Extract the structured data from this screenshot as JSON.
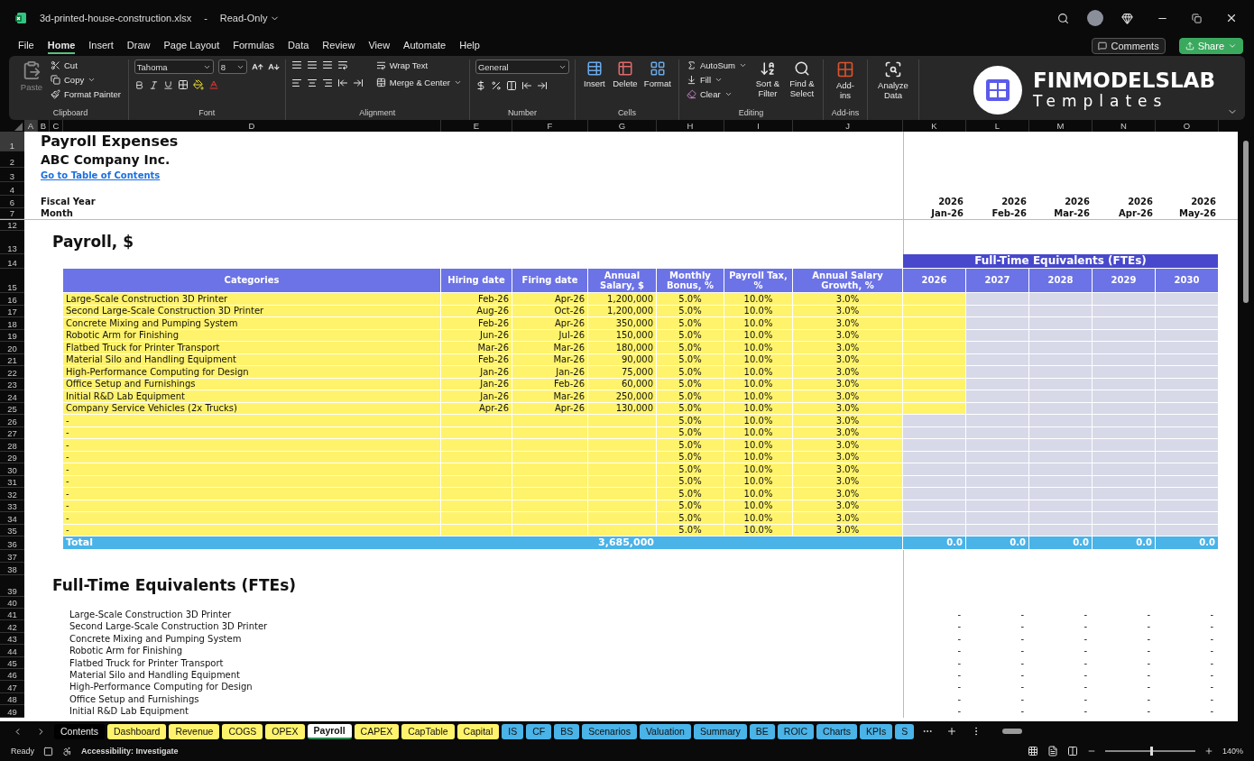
{
  "window": {
    "title": "3d-printed-house-construction.xlsx",
    "separator": "-",
    "mode": "Read-Only"
  },
  "menu": [
    {
      "label": "File",
      "selected": false
    },
    {
      "label": "Home",
      "selected": true
    },
    {
      "label": "Insert",
      "selected": false
    },
    {
      "label": "Draw",
      "selected": false
    },
    {
      "label": "Page Layout",
      "selected": false
    },
    {
      "label": "Formulas",
      "selected": false
    },
    {
      "label": "Data",
      "selected": false
    },
    {
      "label": "Review",
      "selected": false
    },
    {
      "label": "View",
      "selected": false
    },
    {
      "label": "Automate",
      "selected": false
    },
    {
      "label": "Help",
      "selected": false
    }
  ],
  "actions": {
    "comments": "Comments",
    "share": "Share"
  },
  "ribbon": {
    "clipboard": {
      "label": "Clipboard",
      "paste": "Paste",
      "cut": "Cut",
      "copy": "Copy",
      "format_painter": "Format Painter"
    },
    "font": {
      "label": "Font",
      "name": "Tahoma",
      "size": "8"
    },
    "alignment": {
      "label": "Alignment",
      "wrap": "Wrap Text",
      "merge": "Merge & Center"
    },
    "number": {
      "label": "Number",
      "format": "General"
    },
    "cells": {
      "label": "Cells",
      "insert": "Insert",
      "delete": "Delete",
      "format": "Format"
    },
    "editing": {
      "label": "Editing",
      "autosum": "AutoSum",
      "fill": "Fill",
      "clear": "Clear",
      "sort": "Sort & Filter",
      "find": "Find & Select"
    },
    "addins": {
      "label": "Add-ins",
      "button": "Add-ins"
    },
    "analyze": {
      "button": "Analyze Data"
    },
    "brand": {
      "name": "FINMODELSLAB",
      "tagline": "Templates"
    }
  },
  "columns": [
    {
      "label": "A",
      "selected": true
    },
    {
      "label": "B",
      "selected": false
    },
    {
      "label": "C",
      "selected": false
    },
    {
      "label": "D",
      "selected": false
    },
    {
      "label": "E",
      "selected": false
    },
    {
      "label": "F",
      "selected": false
    },
    {
      "label": "G",
      "selected": false
    },
    {
      "label": "H",
      "selected": false
    },
    {
      "label": "I",
      "selected": false
    },
    {
      "label": "J",
      "selected": false
    },
    {
      "label": "K",
      "selected": false
    },
    {
      "label": "L",
      "selected": false
    },
    {
      "label": "M",
      "selected": false
    },
    {
      "label": "N",
      "selected": false
    },
    {
      "label": "O",
      "selected": false
    }
  ],
  "row_numbers": [
    {
      "label": "1",
      "selected": true
    },
    {
      "label": "2",
      "selected": false
    },
    {
      "label": "3",
      "selected": false
    },
    {
      "label": "4",
      "selected": false
    },
    {
      "label": "6",
      "selected": false
    },
    {
      "label": "7",
      "selected": false
    },
    {
      "label": "12",
      "selected": false
    },
    {
      "label": "13",
      "selected": false
    },
    {
      "label": "14",
      "selected": false
    },
    {
      "label": "15",
      "selected": false
    },
    {
      "label": "16",
      "selected": false
    },
    {
      "label": "17",
      "selected": false
    },
    {
      "label": "18",
      "selected": false
    },
    {
      "label": "19",
      "selected": false
    },
    {
      "label": "20",
      "selected": false
    },
    {
      "label": "21",
      "selected": false
    },
    {
      "label": "22",
      "selected": false
    },
    {
      "label": "23",
      "selected": false
    },
    {
      "label": "24",
      "selected": false
    },
    {
      "label": "25",
      "selected": false
    },
    {
      "label": "26",
      "selected": false
    },
    {
      "label": "27",
      "selected": false
    },
    {
      "label": "28",
      "selected": false
    },
    {
      "label": "29",
      "selected": false
    },
    {
      "label": "30",
      "selected": false
    },
    {
      "label": "31",
      "selected": false
    },
    {
      "label": "32",
      "selected": false
    },
    {
      "label": "33",
      "selected": false
    },
    {
      "label": "34",
      "selected": false
    },
    {
      "label": "35",
      "selected": false
    },
    {
      "label": "36",
      "selected": false
    },
    {
      "label": "37",
      "selected": false
    },
    {
      "label": "38",
      "selected": false
    },
    {
      "label": "39",
      "selected": false
    },
    {
      "label": "40",
      "selected": false
    },
    {
      "label": "41",
      "selected": false
    },
    {
      "label": "42",
      "selected": false
    },
    {
      "label": "43",
      "selected": false
    },
    {
      "label": "44",
      "selected": false
    },
    {
      "label": "45",
      "selected": false
    },
    {
      "label": "46",
      "selected": false
    },
    {
      "label": "47",
      "selected": false
    },
    {
      "label": "48",
      "selected": false
    },
    {
      "label": "49",
      "selected": false
    }
  ],
  "sheet": {
    "title": "Payroll Expenses",
    "company": "ABC Company Inc.",
    "toc_link": "Go to Table of Contents",
    "fiscal_year_label": "Fiscal Year",
    "month_label": "Month",
    "periods": [
      {
        "year": "2026",
        "month": "Jan-26"
      },
      {
        "year": "2026",
        "month": "Feb-26"
      },
      {
        "year": "2026",
        "month": "Mar-26"
      },
      {
        "year": "2026",
        "month": "Apr-26"
      },
      {
        "year": "2026",
        "month": "May-26"
      }
    ]
  },
  "payroll": {
    "title": "Payroll, $",
    "headers": [
      "Categories",
      "Hiring date",
      "Firing date",
      "Annual Salary, $",
      "Monthly Bonus, %",
      "Payroll Tax, %",
      "Annual Salary Growth, %"
    ],
    "fte_title": "Full-Time Equivalents (FTEs)",
    "fte_years": [
      "2026",
      "2027",
      "2028",
      "2029",
      "2030"
    ],
    "rows": [
      {
        "category": "Large-Scale Construction 3D Printer",
        "hiring": "Feb-26",
        "firing": "Apr-26",
        "salary": "1,200,000",
        "bonus": "5.0%",
        "tax": "10.0%",
        "growth": "3.0%",
        "fte_input": true
      },
      {
        "category": "Second Large-Scale Construction 3D Printer",
        "hiring": "Aug-26",
        "firing": "Oct-26",
        "salary": "1,200,000",
        "bonus": "5.0%",
        "tax": "10.0%",
        "growth": "3.0%",
        "fte_input": true
      },
      {
        "category": "Concrete Mixing and Pumping System",
        "hiring": "Feb-26",
        "firing": "Apr-26",
        "salary": "350,000",
        "bonus": "5.0%",
        "tax": "10.0%",
        "growth": "3.0%",
        "fte_input": true
      },
      {
        "category": "Robotic Arm for Finishing",
        "hiring": "Jun-26",
        "firing": "Jul-26",
        "salary": "150,000",
        "bonus": "5.0%",
        "tax": "10.0%",
        "growth": "3.0%",
        "fte_input": true
      },
      {
        "category": "Flatbed Truck for Printer Transport",
        "hiring": "Mar-26",
        "firing": "Mar-26",
        "salary": "180,000",
        "bonus": "5.0%",
        "tax": "10.0%",
        "growth": "3.0%",
        "fte_input": true
      },
      {
        "category": "Material Silo and Handling Equipment",
        "hiring": "Feb-26",
        "firing": "Mar-26",
        "salary": "90,000",
        "bonus": "5.0%",
        "tax": "10.0%",
        "growth": "3.0%",
        "fte_input": true
      },
      {
        "category": "High-Performance Computing for Design",
        "hiring": "Jan-26",
        "firing": "Jan-26",
        "salary": "75,000",
        "bonus": "5.0%",
        "tax": "10.0%",
        "growth": "3.0%",
        "fte_input": true
      },
      {
        "category": "Office Setup and Furnishings",
        "hiring": "Jan-26",
        "firing": "Feb-26",
        "salary": "60,000",
        "bonus": "5.0%",
        "tax": "10.0%",
        "growth": "3.0%",
        "fte_input": true
      },
      {
        "category": "Initial R&D Lab Equipment",
        "hiring": "Jan-26",
        "firing": "Mar-26",
        "salary": "250,000",
        "bonus": "5.0%",
        "tax": "10.0%",
        "growth": "3.0%",
        "fte_input": true
      },
      {
        "category": "Company Service Vehicles (2x Trucks)",
        "hiring": "Apr-26",
        "firing": "Apr-26",
        "salary": "130,000",
        "bonus": "5.0%",
        "tax": "10.0%",
        "growth": "3.0%",
        "fte_input": true
      },
      {
        "category": "-",
        "bonus": "5.0%",
        "tax": "10.0%",
        "growth": "3.0%",
        "fte_input": false
      },
      {
        "category": "-",
        "bonus": "5.0%",
        "tax": "10.0%",
        "growth": "3.0%",
        "fte_input": false
      },
      {
        "category": "-",
        "bonus": "5.0%",
        "tax": "10.0%",
        "growth": "3.0%",
        "fte_input": false
      },
      {
        "category": "-",
        "bonus": "5.0%",
        "tax": "10.0%",
        "growth": "3.0%",
        "fte_input": false
      },
      {
        "category": "-",
        "bonus": "5.0%",
        "tax": "10.0%",
        "growth": "3.0%",
        "fte_input": false
      },
      {
        "category": "-",
        "bonus": "5.0%",
        "tax": "10.0%",
        "growth": "3.0%",
        "fte_input": false
      },
      {
        "category": "-",
        "bonus": "5.0%",
        "tax": "10.0%",
        "growth": "3.0%",
        "fte_input": false
      },
      {
        "category": "-",
        "bonus": "5.0%",
        "tax": "10.0%",
        "growth": "3.0%",
        "fte_input": false
      },
      {
        "category": "-",
        "bonus": "5.0%",
        "tax": "10.0%",
        "growth": "3.0%",
        "fte_input": false
      },
      {
        "category": "-",
        "bonus": "5.0%",
        "tax": "10.0%",
        "growth": "3.0%",
        "fte_input": false
      }
    ],
    "total": {
      "label": "Total",
      "salary": "3,685,000",
      "fte": [
        "0.0",
        "0.0",
        "0.0",
        "0.0",
        "0.0"
      ]
    }
  },
  "fte": {
    "title": "Full-Time Equivalents (FTEs)",
    "rows": [
      {
        "name": "Large-Scale Construction 3D Printer",
        "values": [
          "-",
          "-",
          "-",
          "-",
          "-"
        ]
      },
      {
        "name": "Second Large-Scale Construction 3D Printer",
        "values": [
          "-",
          "-",
          "-",
          "-",
          "-"
        ]
      },
      {
        "name": "Concrete Mixing and Pumping System",
        "values": [
          "-",
          "-",
          "-",
          "-",
          "-"
        ]
      },
      {
        "name": "Robotic Arm for Finishing",
        "values": [
          "-",
          "-",
          "-",
          "-",
          "-"
        ]
      },
      {
        "name": "Flatbed Truck for Printer Transport",
        "values": [
          "-",
          "-",
          "-",
          "-",
          "-"
        ]
      },
      {
        "name": "Material Silo and Handling Equipment",
        "values": [
          "-",
          "-",
          "-",
          "-",
          "-"
        ]
      },
      {
        "name": "High-Performance Computing for Design",
        "values": [
          "-",
          "-",
          "-",
          "-",
          "-"
        ]
      },
      {
        "name": "Office Setup and Furnishings",
        "values": [
          "-",
          "-",
          "-",
          "-",
          "-"
        ]
      },
      {
        "name": "Initial R&D Lab Equipment",
        "values": [
          "-",
          "-",
          "-",
          "-",
          "-"
        ]
      }
    ]
  },
  "sheet_tabs": [
    {
      "label": "Contents",
      "selected": false,
      "color": "#000000"
    },
    {
      "label": "Dashboard",
      "selected": false,
      "color": "#fff36b"
    },
    {
      "label": "Revenue",
      "selected": false,
      "color": "#fff36b"
    },
    {
      "label": "COGS",
      "selected": false,
      "color": "#fff36b"
    },
    {
      "label": "OPEX",
      "selected": false,
      "color": "#fff36b"
    },
    {
      "label": "Payroll",
      "selected": true
    },
    {
      "label": "CAPEX",
      "selected": false,
      "color": "#fff36b"
    },
    {
      "label": "CapTable",
      "selected": false,
      "color": "#fff36b"
    },
    {
      "label": "Capital",
      "selected": false,
      "color": "#fff36b"
    },
    {
      "label": "IS",
      "selected": false,
      "color": "#4ab3e8"
    },
    {
      "label": "CF",
      "selected": false,
      "color": "#4ab3e8"
    },
    {
      "label": "BS",
      "selected": false,
      "color": "#4ab3e8"
    },
    {
      "label": "Scenarios",
      "selected": false,
      "color": "#4ab3e8"
    },
    {
      "label": "Valuation",
      "selected": false,
      "color": "#4ab3e8"
    },
    {
      "label": "Summary",
      "selected": false,
      "color": "#4ab3e8"
    },
    {
      "label": "BE",
      "selected": false,
      "color": "#4ab3e8"
    },
    {
      "label": "ROIC",
      "selected": false,
      "color": "#4ab3e8"
    },
    {
      "label": "Charts",
      "selected": false,
      "color": "#4ab3e8"
    },
    {
      "label": "KPIs",
      "selected": false,
      "color": "#4ab3e8"
    },
    {
      "label": "S",
      "selected": false,
      "color": "#4ab3e8"
    }
  ],
  "status": {
    "ready": "Ready",
    "accessibility": "Accessibility: Investigate",
    "zoom": "140%",
    "zoom_level": {
      "level": 0.5
    }
  }
}
